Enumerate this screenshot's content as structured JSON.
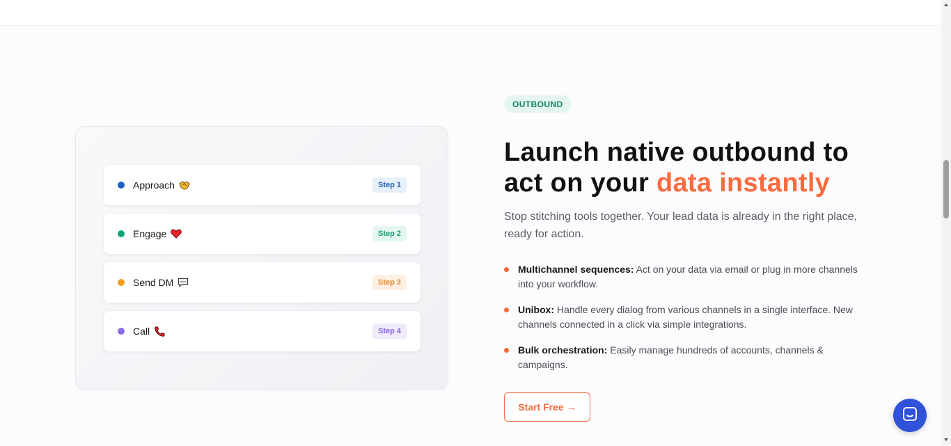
{
  "steps": [
    {
      "label": "Approach",
      "badge": "Step 1",
      "dot_color": "#1e5fbf",
      "badge_bg": "#e6f0fb",
      "badge_fg": "#2a65b5",
      "icon": "handshake-icon"
    },
    {
      "label": "Engage",
      "badge": "Step 2",
      "dot_color": "#12a37a",
      "badge_bg": "#e4f7ef",
      "badge_fg": "#1b9f74",
      "icon": "heart-icon"
    },
    {
      "label": "Send DM",
      "badge": "Step 3",
      "dot_color": "#f2a01d",
      "badge_bg": "#fdf0e3",
      "badge_fg": "#e58a2c",
      "icon": "speech-bubble-icon"
    },
    {
      "label": "Call",
      "badge": "Step 4",
      "dot_color": "#8d6ce8",
      "badge_bg": "#f0eafc",
      "badge_fg": "#8a63e3",
      "icon": "phone-icon"
    }
  ],
  "section": {
    "pill": "OUTBOUND",
    "headline_main": "Launch native outbound to act on your ",
    "headline_highlight": "data instantly",
    "subtitle": "Stop stitching tools together. Your lead data is already in the right place, ready for action."
  },
  "features": [
    {
      "title": "Multichannel sequences:",
      "text": " Act on your data via email or plug in more channels into your workflow."
    },
    {
      "title": "Unibox:",
      "text": " Handle every dialog from various channels in a single interface. New channels connected in a click via simple integrations."
    },
    {
      "title": "Bulk orchestration:",
      "text": " Easily manage hundreds of accounts, channels & campaigns."
    }
  ],
  "cta": {
    "label": "Start Free",
    "arrow": "→"
  },
  "colors": {
    "accent": "#fa6b3f",
    "pill_bg": "#e5f6ef",
    "pill_fg": "#12845a",
    "chat_bg": "#2f52d8"
  }
}
